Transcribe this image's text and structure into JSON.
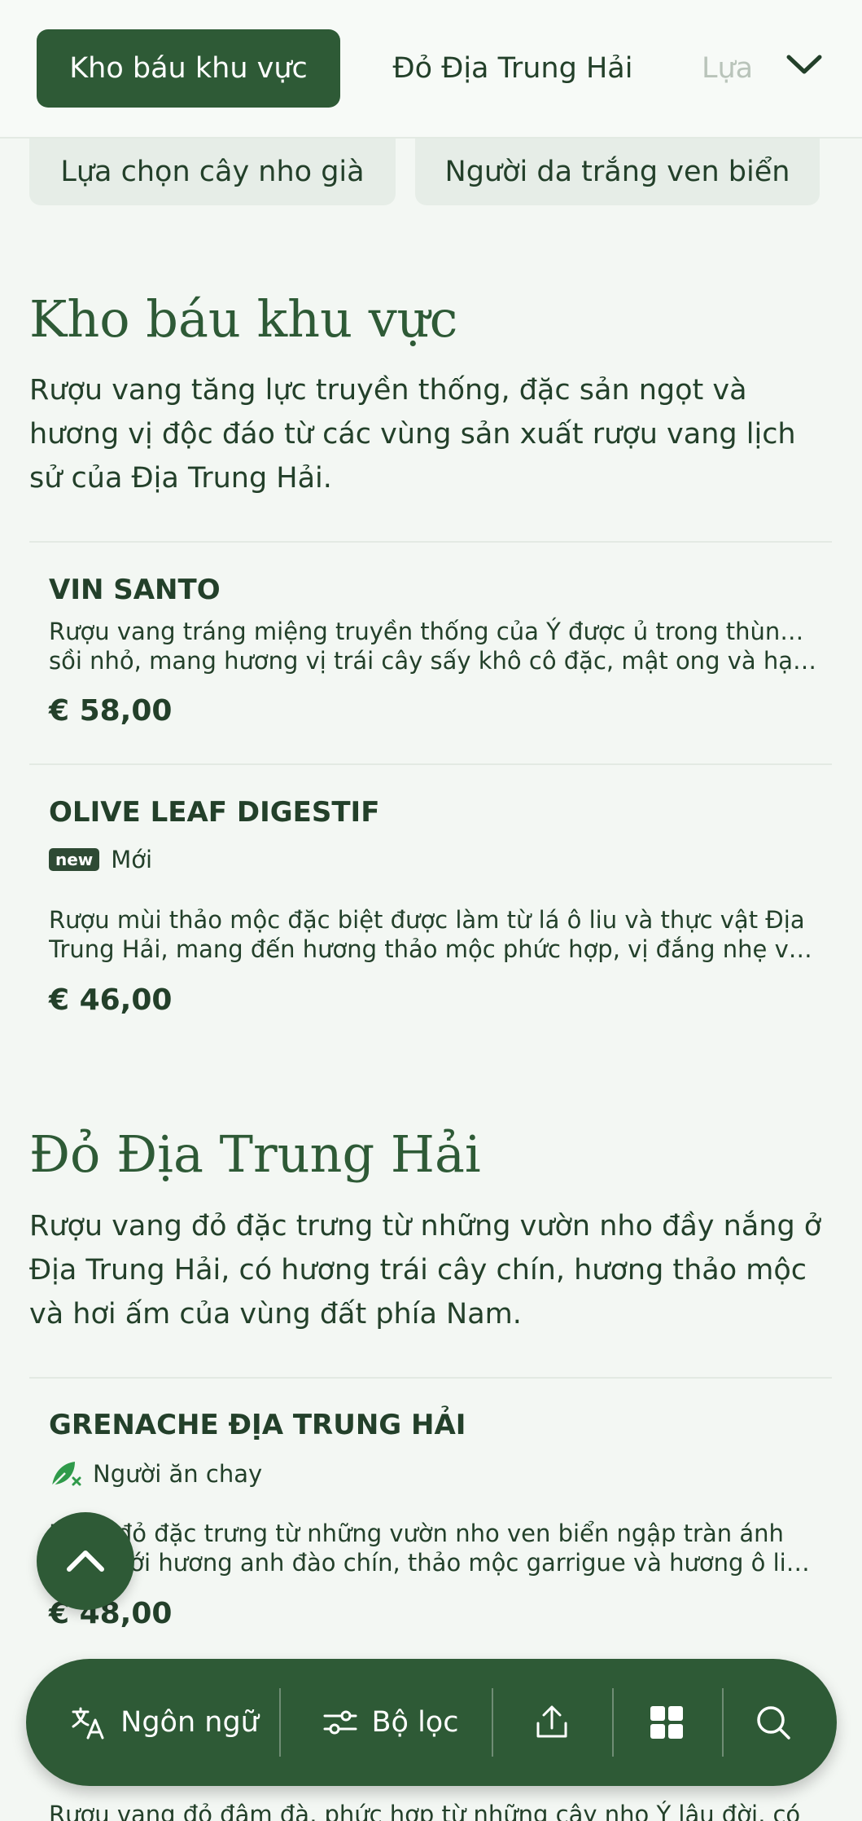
{
  "nav": {
    "tabs": [
      {
        "label": "Kho báu khu vực",
        "active": true
      },
      {
        "label": "Đỏ Địa Trung Hải",
        "active": false
      },
      {
        "label": "Lựa",
        "active": false
      }
    ],
    "subchips": [
      "Lựa chọn cây nho già",
      "Người da trắng ven biển"
    ]
  },
  "sections": [
    {
      "title": "Kho báu khu vực",
      "description": "Rượu vang tăng lực truyền thống, đặc sản ngọt và hương vị độc đáo từ các vùng sản xuất rượu vang lịch sử của Địa Trung Hải.",
      "items": [
        {
          "name": "VIN SANTO",
          "desc_line1": "Rượu vang tráng miệng truyền thống của Ý được ủ trong thùng gỗ",
          "desc_line2": "sồi nhỏ, mang hương vị trái cây sấy khô cô đặc, mật ong và hạt ...",
          "price": "€ 58,00"
        },
        {
          "name": "OLIVE LEAF DIGESTIF",
          "badge_tag": "new",
          "badge_label": "Mới",
          "desc_line1": "Rượu mùi thảo mộc đặc biệt được làm từ lá ô liu và thực vật Địa",
          "desc_line2": "Trung Hải, mang đến hương thảo mộc phức hợp, vị đắng nhẹ và...",
          "price": "€ 46,00"
        }
      ]
    },
    {
      "title": "Đỏ Địa Trung Hải",
      "description": "Rượu vang đỏ đặc trưng từ những vườn nho đầy nắng ở Địa Trung Hải, có hương trái cây chín, hương thảo mộc và hơi ấm của vùng đất phía Nam.",
      "items": [
        {
          "name": "GRENACHE ĐỊA TRUNG HẢI",
          "badge_label": "Người ăn chay",
          "desc_line1": "Rượu đỏ đặc trưng từ những vườn nho ven biển ngập tràn ánh",
          "desc_line2": "nắng với hương anh đào chín, thảo mộc garrigue và hương ô liu...",
          "price": "€ 48,00"
        }
      ],
      "next_item_desc": "Rượu vang đỏ đậm đà, phức hợp từ những cây nho Ý lâu đời, có"
    }
  ],
  "bottom_bar": {
    "language_label": "Ngôn ngữ",
    "filter_label": "Bộ lọc"
  },
  "icons": {
    "chevron": "chevron-down-icon",
    "scroll_top": "chevron-up-icon",
    "language": "translate-icon",
    "filter": "sliders-icon",
    "share": "share-icon",
    "grid": "grid-icon",
    "search": "search-icon",
    "vegan": "leaf-icon"
  },
  "colors": {
    "primary": "#2e5a36",
    "background": "#f3f7f3",
    "chip": "#e6ede7",
    "text": "#23402a"
  }
}
